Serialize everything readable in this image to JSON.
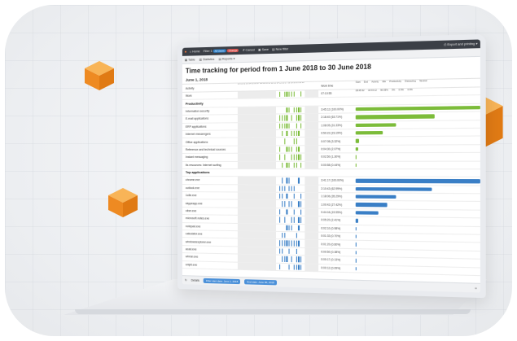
{
  "colors": {
    "green": "#7cbc3a",
    "blue": "#3a7fc6",
    "orange": "#f29a2e",
    "topbar": "#3b3f46"
  },
  "toolbar": {
    "home": "Home",
    "filter": "Filter 1",
    "badge_blue": "All Users",
    "badge_red": "Change",
    "cancel": "Cancel",
    "save": "Save",
    "new_filter": "New filter",
    "export": "Export and printing"
  },
  "tabs": {
    "table": "Table",
    "statistics": "Statistics",
    "reports": "Reports"
  },
  "report": {
    "title": "Time tracking for period from 1 June 2018 to 30 June 2018",
    "date": "June 1, 2018",
    "hours": "00 01 02 03 04 05 06 07 08 09 10 11 12 13 14 15 16 17 18 19 20 21 22 23",
    "total_col": "Work time",
    "col_headers": [
      "Start",
      "End",
      "Activity",
      "Idle",
      "Productivity",
      "Distracting",
      "Neutral"
    ],
    "summary_label": "Work",
    "summary_time": "07:10:55",
    "summary_cells": [
      "08:45:32",
      "18:44:12",
      "96.59%",
      "3%",
      "0.5%",
      "0.3%"
    ]
  },
  "sections": [
    {
      "label": "Productivity",
      "rows": [
        {
          "name": "Information security",
          "time": "3:45:12 (100.00%)",
          "pct": 100
        },
        {
          "name": "E-mail applications",
          "time": "2:18:40 (63.71%)",
          "pct": 64
        },
        {
          "name": "ERP applications",
          "time": "1:08:05 (31.33%)",
          "pct": 33
        },
        {
          "name": "Internet messengers",
          "time": "0:50:22 (23.19%)",
          "pct": 22
        },
        {
          "name": "Office applications",
          "time": "0:07:08 (3.32%)",
          "pct": 3
        },
        {
          "name": "Reference and technical sources",
          "time": "0:04:30 (2.07%)",
          "pct": 2
        },
        {
          "name": "Instant messaging",
          "time": "0:02:50 (1.30%)",
          "pct": 1
        },
        {
          "name": "Its resources: Internet surfing",
          "time": "0:00:58 (0.44%)",
          "pct": 0.4
        }
      ]
    },
    {
      "label": "Top applications",
      "rows": [
        {
          "name": "chrome.exe",
          "time": "3:41:17 (100.00%)",
          "pct": 100
        },
        {
          "name": "outlook.exe",
          "time": "2:10:43 (62.99%)",
          "pct": 62
        },
        {
          "name": "1c8e.exe",
          "time": "1:18:06 (35.29%)",
          "pct": 33
        },
        {
          "name": "skypeapp.exe",
          "time": "1:00:42 (27.42%)",
          "pct": 26
        },
        {
          "name": "viber.exe",
          "time": "0:44:16 (19.99%)",
          "pct": 19
        },
        {
          "name": "microsoft.notes.exe",
          "time": "0:05:20 (2.41%)",
          "pct": 2.4
        },
        {
          "name": "notepad.exe",
          "time": "0:02:10 (0.98%)",
          "pct": 1
        },
        {
          "name": "calculator.exe",
          "time": "0:01:33 (0.70%)",
          "pct": 0.7
        },
        {
          "name": "windowsexplorer.exe",
          "time": "0:01:20 (0.60%)",
          "pct": 0.6
        },
        {
          "name": "acad.exe",
          "time": "0:00:50 (0.38%)",
          "pct": 0.4
        },
        {
          "name": "winrar.exe",
          "time": "0:00:17 (0.13%)",
          "pct": 0.2
        },
        {
          "name": "snipit.exe",
          "time": "0:00:12 (0.09%)",
          "pct": 0.1
        }
      ]
    }
  ],
  "footer": {
    "details": "Details",
    "chip1": "Filter start date: June 1, 2018",
    "chip2": "End date: June 30, 2018"
  }
}
